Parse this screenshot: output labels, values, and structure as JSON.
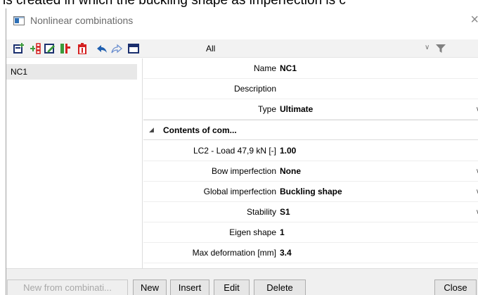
{
  "caption": "is created in which the buckling shape as imperfection is c",
  "window": {
    "title": "Nonlinear combinations",
    "close_glyph": "×"
  },
  "toolbar": {
    "filter_label": "All",
    "icons": [
      "new-icon",
      "insert-icon",
      "edit-icon",
      "copy-icon",
      "delete-icon",
      "undo-icon",
      "redo-icon",
      "window-icon",
      "dropdown-icon",
      "filter-icon"
    ],
    "colors": {
      "green": "#3c9a3c",
      "red": "#d42020",
      "blue": "#2060b0",
      "navy": "#1a2f6e"
    }
  },
  "list": {
    "items": [
      {
        "label": "NC1"
      }
    ]
  },
  "properties": {
    "rows": [
      {
        "name": "Name",
        "value": "NC1"
      },
      {
        "name": "Description",
        "value": ""
      },
      {
        "name": "Type",
        "value": "Ultimate"
      }
    ],
    "section_title": "Contents of com...",
    "section_rows": [
      {
        "name": "LC2 - Load 47,9 kN [-]",
        "value": "1.00"
      },
      {
        "name": "Bow imperfection",
        "value": "None"
      },
      {
        "name": "Global imperfection",
        "value": "Buckling shape"
      },
      {
        "name": "Stability",
        "value": "S1"
      },
      {
        "name": "Eigen shape",
        "value": "1"
      },
      {
        "name": "Max deformation [mm]",
        "value": "3.4"
      }
    ]
  },
  "buttons": {
    "new_from": "New from combinati...",
    "new": "New",
    "insert": "Insert",
    "edit": "Edit",
    "delete": "Delete",
    "close": "Close"
  }
}
